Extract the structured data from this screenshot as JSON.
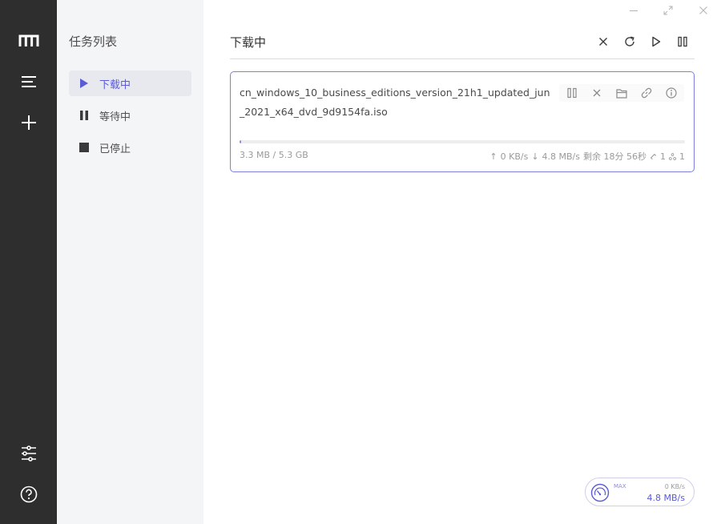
{
  "sidebar": {
    "title": "任务列表",
    "items": [
      {
        "label": "下载中",
        "icon": "play-icon",
        "active": true
      },
      {
        "label": "等待中",
        "icon": "pause-icon",
        "active": false
      },
      {
        "label": "已停止",
        "icon": "stop-icon",
        "active": false
      }
    ]
  },
  "main": {
    "title": "下载中"
  },
  "task": {
    "name": "cn_windows_10_business_editions_version_21h1_updated_jun_2021_x64_dvd_9d9154fa.iso",
    "size": "3.3 MB / 5.3 GB",
    "progress_percent": 0.06,
    "upload_speed": "0 KB/s",
    "download_speed": "4.8 MB/s",
    "remaining": "剩余 18分 56秒",
    "connections": "1",
    "seeders": "1"
  },
  "speedometer": {
    "max_label": "MAX",
    "upload": "0 KB/s",
    "download": "4.8 MB/s"
  },
  "colors": {
    "accent": "#5b5bd6",
    "rail_bg": "#2e2e2e",
    "side_bg": "#f4f5f7"
  }
}
